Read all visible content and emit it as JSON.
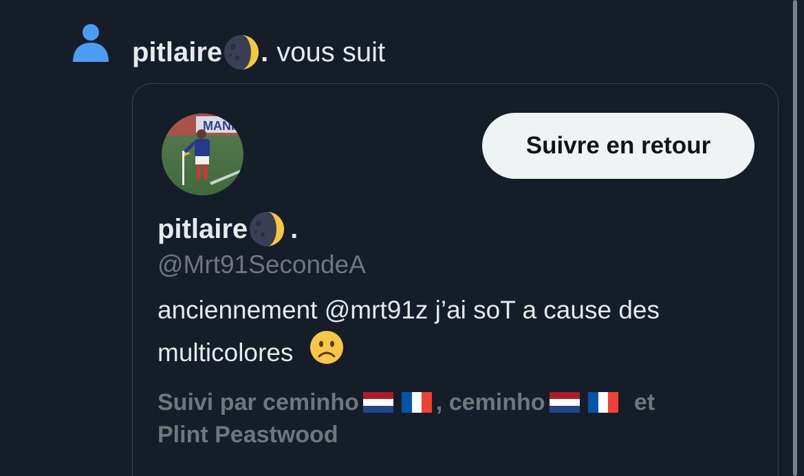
{
  "notification": {
    "icon": "person-icon",
    "user_name": "pitlaire",
    "name_suffix": ".",
    "action_text": "vous suit",
    "colors": {
      "icon": "#4a9df0",
      "text": "#e7e9ea"
    }
  },
  "card": {
    "avatar": "avatar",
    "follow_button_label": "Suivre en retour",
    "name": "pitlaire",
    "name_suffix": ".",
    "handle": "@Mrt91SecondeA",
    "bio": "anciennement @mrt91z j’ai soT a cause des multicolores",
    "followed_by_prefix": "Suivi par ceminho",
    "followed_by_sep": ", ceminho",
    "followed_by_and": "et",
    "followed_by_last": "Plint Peastwood",
    "colors": {
      "border": "#38444d",
      "button_bg": "#eff3f4",
      "muted": "#71767b"
    }
  }
}
